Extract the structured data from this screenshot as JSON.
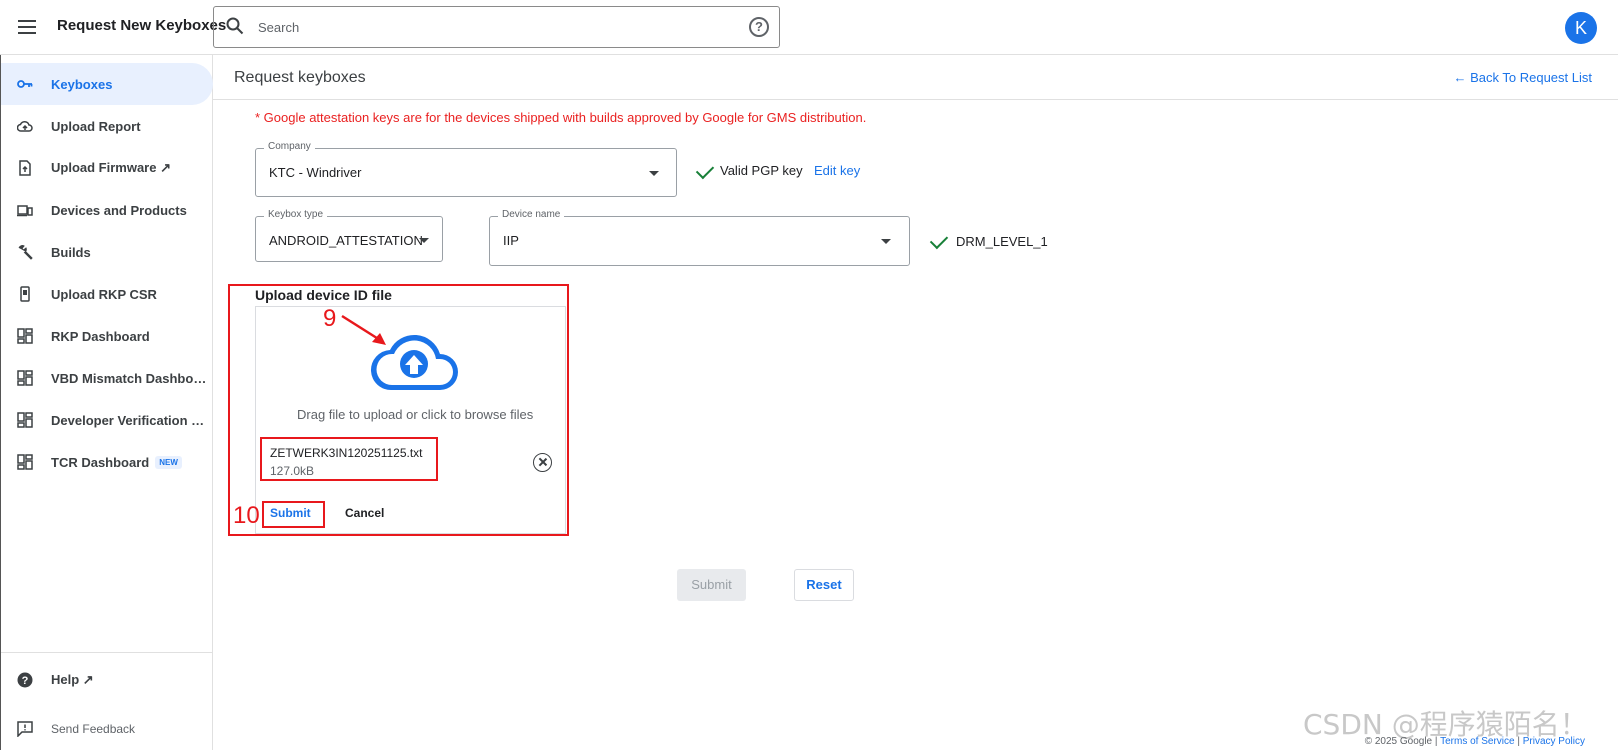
{
  "header": {
    "title": "Request New Keyboxes",
    "search_placeholder": "Search",
    "help_glyph": "?",
    "avatar_letter": "K"
  },
  "sidebar": {
    "items": [
      {
        "label": "Keyboxes",
        "icon": "key-icon",
        "active": true
      },
      {
        "label": "Upload Report",
        "icon": "cloud-upload-icon"
      },
      {
        "label": "Upload Firmware ↗",
        "icon": "file-upload-icon"
      },
      {
        "label": "Devices and Products",
        "icon": "devices-icon"
      },
      {
        "label": "Builds",
        "icon": "wrench-icon"
      },
      {
        "label": "Upload RKP CSR",
        "icon": "phone-icon"
      },
      {
        "label": "RKP Dashboard",
        "icon": "dashboard-icon"
      },
      {
        "label": "VBD Mismatch Dashboard",
        "icon": "dashboard-icon"
      },
      {
        "label": "Developer Verification Dashboard",
        "icon": "dashboard-icon"
      },
      {
        "label": "TCR Dashboard",
        "icon": "dashboard-icon",
        "badge": "NEW"
      }
    ],
    "help_label": "Help ↗",
    "feedback_label": "Send Feedback"
  },
  "main": {
    "page_title": "Request keyboxes",
    "back_link": "Back To Request List",
    "warning": "* Google attestation keys are for the devices shipped with builds approved by Google for GMS distribution.",
    "company": {
      "legend": "Company",
      "value": "KTC - Windriver"
    },
    "pgp_status": "Valid PGP key",
    "edit_key": "Edit key",
    "keybox_type": {
      "legend": "Keybox type",
      "value": "ANDROID_ATTESTATION"
    },
    "device_name": {
      "legend": "Device name",
      "value": "IIP"
    },
    "drm_level": "DRM_LEVEL_1",
    "upload": {
      "title": "Upload device ID file",
      "instruction": "Drag file to upload or click to browse files",
      "file_name": "ZETWERK3IN120251125.txt",
      "file_size": "127.0kB",
      "submit_label": "Submit",
      "cancel_label": "Cancel"
    },
    "submit_label": "Submit",
    "reset_label": "Reset"
  },
  "annotations": {
    "step9": "9",
    "step10": "10"
  },
  "watermark": "CSDN @程序猿陌名！",
  "footer": {
    "copyright": "© 2025 Google",
    "sep": "|",
    "terms": "Terms of Service",
    "privacy": "Privacy Policy"
  },
  "colors": {
    "accent": "#1a73e8",
    "annotation": "#e8181c",
    "success": "#188038",
    "warning": "#ea2121"
  }
}
